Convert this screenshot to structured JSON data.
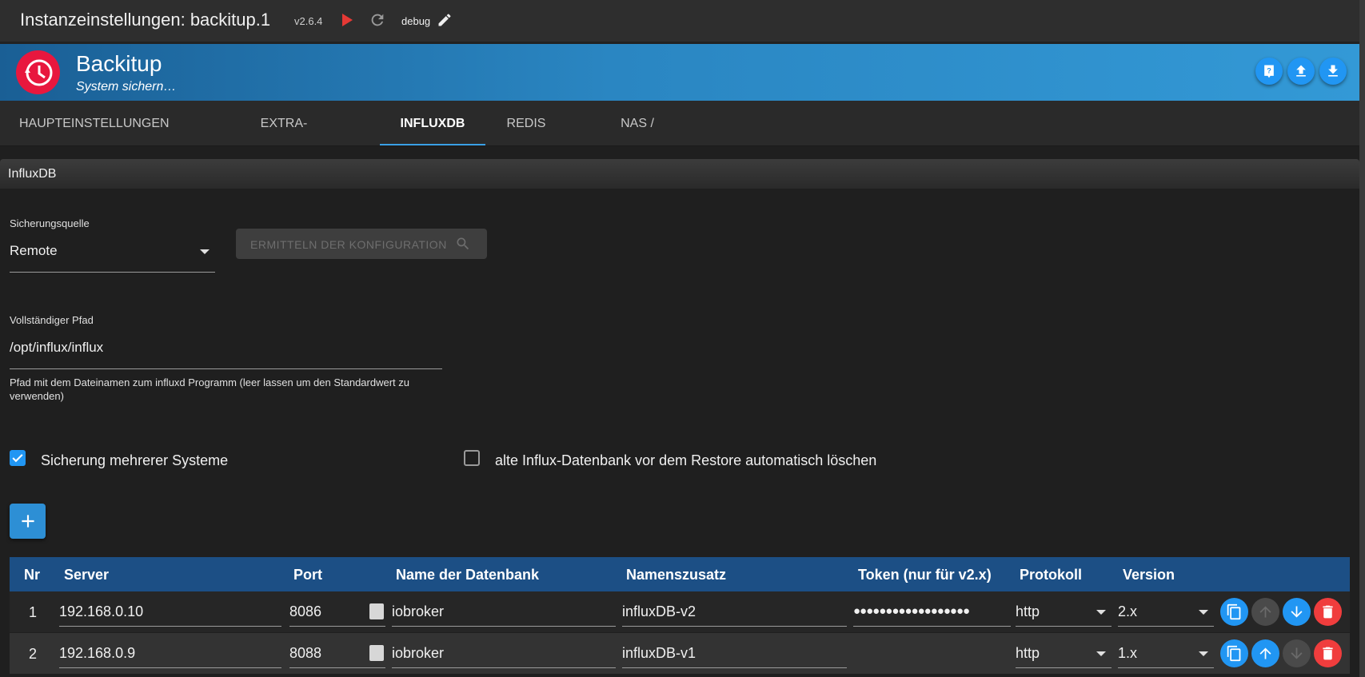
{
  "topbar": {
    "title": "Instanzeinstellungen: backitup.1",
    "version": "v2.6.4",
    "debug": "debug"
  },
  "banner": {
    "app_name": "Backitup",
    "subtitle": "System sichern…"
  },
  "tabs": [
    {
      "label": "HAUPTEINSTELLUNGEN"
    },
    {
      "label": "EXTRA-EINSTELLUNGEN"
    },
    {
      "label": "INFLUXDB",
      "active": true
    },
    {
      "label": "REDIS"
    },
    {
      "label": "NAS / KOPIEREN"
    }
  ],
  "section": {
    "title": "InfluxDB"
  },
  "form": {
    "source_label": "Sicherungsquelle",
    "source_value": "Remote",
    "detect_button": "ERMITTELN DER KONFIGURATION",
    "path_label": "Vollständiger Pfad",
    "path_value": "/opt/influx/influx",
    "path_helper": "Pfad mit dem Dateinamen zum influxd Programm (leer lassen um den Standardwert zu verwenden)",
    "multi_label": "Sicherung mehrerer Systeme",
    "multi_checked": true,
    "delete_label": "alte Influx-Datenbank vor dem Restore automatisch löschen",
    "delete_checked": false
  },
  "table": {
    "headers": [
      "Nr",
      "Server",
      "Port",
      "Name der Datenbank",
      "Namenszusatz",
      "Token (nur für v2.x)",
      "Protokoll",
      "Version"
    ],
    "rows": [
      {
        "nr": "1",
        "server": "192.168.0.10",
        "port": "8086",
        "db": "iobroker",
        "suffix": "influxDB-v2",
        "token": "●●●●●●●●●●●●●●●●●●",
        "protocol": "http",
        "version": "2.x"
      },
      {
        "nr": "2",
        "server": "192.168.0.9",
        "port": "8088",
        "db": "iobroker",
        "suffix": "influxDB-v1",
        "token": "",
        "protocol": "http",
        "version": "1.x"
      }
    ]
  },
  "colors": {
    "accent": "#2196f3",
    "header_blue": "#1c4f85",
    "danger": "#f03d3d",
    "logo_red": "#e8173e"
  }
}
